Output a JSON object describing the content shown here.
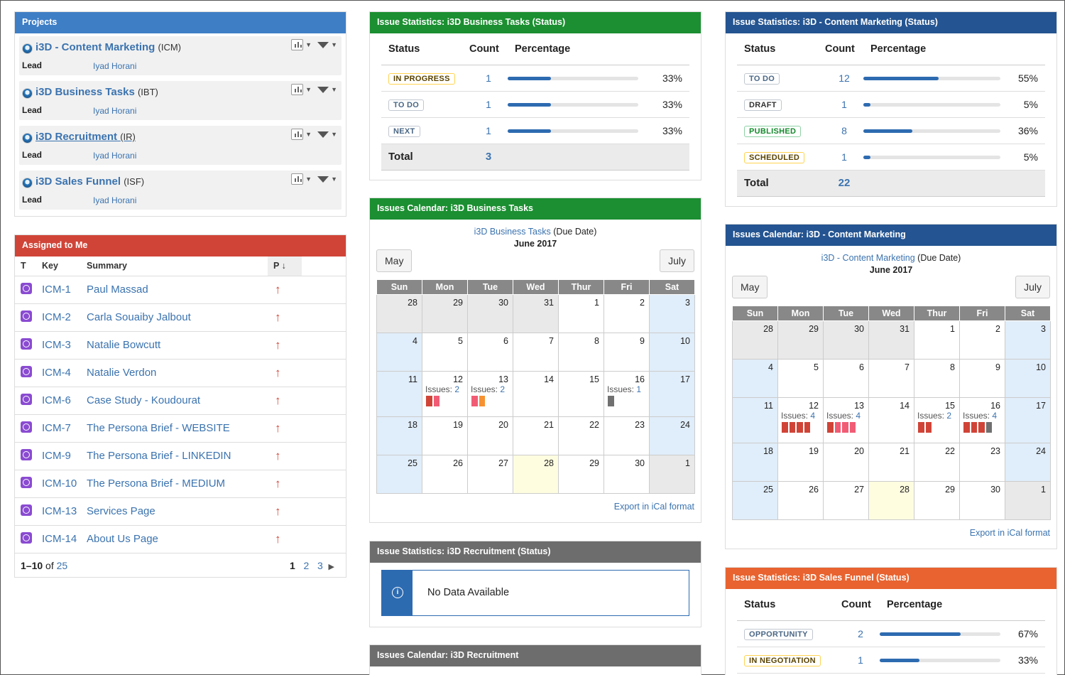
{
  "projects": {
    "title": "Projects",
    "lead_label": "Lead",
    "items": [
      {
        "name": "i3D - Content Marketing",
        "key": "(ICM)",
        "lead": "Iyad Horani"
      },
      {
        "name": "i3D Business Tasks",
        "key": "(IBT)",
        "lead": "Iyad Horani"
      },
      {
        "name": "i3D Recruitment",
        "key": "(IR)",
        "lead": "Iyad Horani"
      },
      {
        "name": "i3D Sales Funnel",
        "key": "(ISF)",
        "lead": "Iyad Horani"
      }
    ]
  },
  "assigned": {
    "title": "Assigned to Me",
    "cols": [
      "T",
      "Key",
      "Summary",
      "P"
    ],
    "rows": [
      {
        "key": "ICM-1",
        "summary": "Paul Massad"
      },
      {
        "key": "ICM-2",
        "summary": "Carla Souaiby Jalbout"
      },
      {
        "key": "ICM-3",
        "summary": "Natalie Bowcutt"
      },
      {
        "key": "ICM-4",
        "summary": "Natalie Verdon"
      },
      {
        "key": "ICM-6",
        "summary": "Case Study - Koudourat"
      },
      {
        "key": "ICM-7",
        "summary": "The Persona Brief - WEBSITE"
      },
      {
        "key": "ICM-9",
        "summary": "The Persona Brief - LINKEDIN"
      },
      {
        "key": "ICM-10",
        "summary": "The Persona Brief - MEDIUM"
      },
      {
        "key": "ICM-13",
        "summary": "Services Page"
      },
      {
        "key": "ICM-14",
        "summary": "About Us Page"
      }
    ],
    "range": "1–10",
    "of": "of",
    "total": "25",
    "pages": [
      "1",
      "2",
      "3"
    ]
  },
  "stats_ibt": {
    "title": "Issue Statistics: i3D Business Tasks (Status)",
    "cols": [
      "Status",
      "Count",
      "Percentage"
    ],
    "rows": [
      {
        "status": "IN PROGRESS",
        "count": "1",
        "pct": "33%",
        "frac": 0.33
      },
      {
        "status": "TO DO",
        "count": "1",
        "pct": "33%",
        "frac": 0.33
      },
      {
        "status": "NEXT",
        "count": "1",
        "pct": "33%",
        "frac": 0.33
      }
    ],
    "total_label": "Total",
    "total": "3"
  },
  "cal_ibt": {
    "title": "Issues Calendar: i3D Business Tasks",
    "project": "i3D Business Tasks",
    "suffix": "(Due Date)",
    "month": "June 2017",
    "prev": "May",
    "next": "July",
    "export": "Export in iCal format"
  },
  "stats_ir": {
    "title": "Issue Statistics: i3D Recruitment (Status)",
    "message": "No Data Available"
  },
  "cal_ir": {
    "title": "Issues Calendar: i3D Recruitment"
  },
  "stats_icm": {
    "title": "Issue Statistics: i3D - Content Marketing (Status)",
    "cols": [
      "Status",
      "Count",
      "Percentage"
    ],
    "rows": [
      {
        "status": "TO DO",
        "count": "12",
        "pct": "55%",
        "frac": 0.55
      },
      {
        "status": "DRAFT",
        "count": "1",
        "pct": "5%",
        "frac": 0.05
      },
      {
        "status": "PUBLISHED",
        "count": "8",
        "pct": "36%",
        "frac": 0.36
      },
      {
        "status": "SCHEDULED",
        "count": "1",
        "pct": "5%",
        "frac": 0.05
      }
    ],
    "total_label": "Total",
    "total": "22"
  },
  "cal_icm": {
    "title": "Issues Calendar: i3D - Content Marketing",
    "project": "i3D - Content Marketing",
    "suffix": "(Due Date)",
    "month": "June 2017",
    "prev": "May",
    "next": "July",
    "export": "Export in iCal format"
  },
  "stats_isf": {
    "title": "Issue Statistics: i3D Sales Funnel (Status)",
    "cols": [
      "Status",
      "Count",
      "Percentage"
    ],
    "rows": [
      {
        "status": "OPPORTUNITY",
        "count": "2",
        "pct": "67%",
        "frac": 0.67
      },
      {
        "status": "IN NEGOTIATION",
        "count": "1",
        "pct": "33%",
        "frac": 0.33
      }
    ]
  },
  "calendar": {
    "days": [
      "Sun",
      "Mon",
      "Tue",
      "Wed",
      "Thur",
      "Fri",
      "Sat"
    ],
    "weeks": [
      [
        "28",
        "29",
        "30",
        "31",
        "1",
        "2",
        "3"
      ],
      [
        "4",
        "5",
        "6",
        "7",
        "8",
        "9",
        "10"
      ],
      [
        "11",
        "12",
        "13",
        "14",
        "15",
        "16",
        "17"
      ],
      [
        "18",
        "19",
        "20",
        "21",
        "22",
        "23",
        "24"
      ],
      [
        "25",
        "26",
        "27",
        "28",
        "29",
        "30",
        "1"
      ]
    ],
    "issues_label": "Issues:"
  },
  "cal_ibt_issues": {
    "12": {
      "n": "2",
      "c": [
        "#d04437",
        "#f15c75"
      ]
    },
    "13": {
      "n": "2",
      "c": [
        "#f15c75",
        "#f79232"
      ]
    },
    "16": {
      "n": "1",
      "c": [
        "#707070"
      ]
    }
  },
  "cal_icm_issues": {
    "12": {
      "n": "4",
      "c": [
        "#d04437",
        "#d04437",
        "#d04437",
        "#d04437"
      ]
    },
    "13": {
      "n": "4",
      "c": [
        "#d04437",
        "#f15c75",
        "#f15c75",
        "#f15c75"
      ]
    },
    "15": {
      "n": "2",
      "c": [
        "#d04437",
        "#d04437"
      ]
    },
    "16": {
      "n": "4",
      "c": [
        "#d04437",
        "#d04437",
        "#d04437",
        "#707070"
      ]
    }
  }
}
